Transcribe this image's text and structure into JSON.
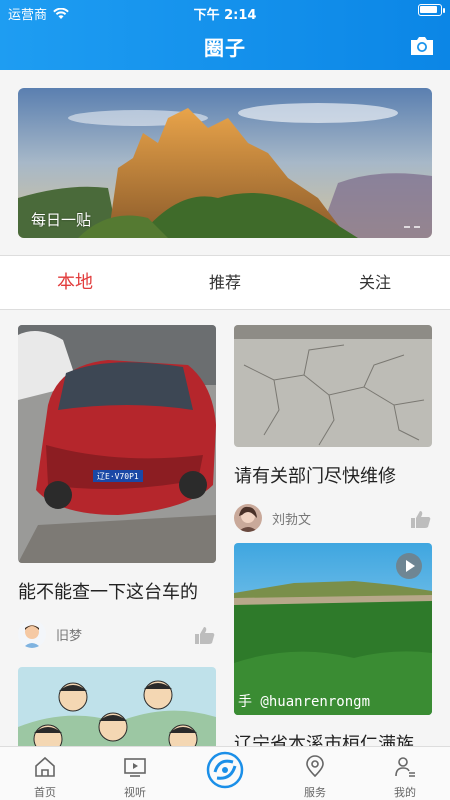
{
  "status": {
    "carrier": "运营商",
    "time": "下午 2:14",
    "battery_level": 0.9
  },
  "header": {
    "title": "圈子",
    "camera_icon": "camera-icon"
  },
  "banner": {
    "caption": "每日一贴"
  },
  "tabs": [
    {
      "label": "本地",
      "active": true
    },
    {
      "label": "推荐",
      "active": false
    },
    {
      "label": "关注",
      "active": false
    }
  ],
  "feed": {
    "left": [
      {
        "title": "能不能查一下这台车的",
        "author": "旧梦",
        "image": "red-car-photo"
      },
      {
        "title": "",
        "author": "",
        "image": "cartoon-faces-photo"
      }
    ],
    "right": [
      {
        "title": "请有关部门尽快维修",
        "author": "刘勃文",
        "image": "cracked-road-photo"
      },
      {
        "title": "辽宁省本溪市桓仁满族",
        "author": "",
        "image": "green-mountain-video",
        "video": true,
        "overlay_text": "手 @huanrenrongm"
      }
    ]
  },
  "nav": [
    {
      "label": "首页",
      "icon": "home-icon"
    },
    {
      "label": "视听",
      "icon": "tv-icon"
    },
    {
      "label": "",
      "icon": "circle-logo-icon"
    },
    {
      "label": "服务",
      "icon": "location-icon"
    },
    {
      "label": "我的",
      "icon": "profile-icon"
    }
  ],
  "colors": {
    "header": "#1e9df2",
    "active_tab": "#e23d3d"
  }
}
